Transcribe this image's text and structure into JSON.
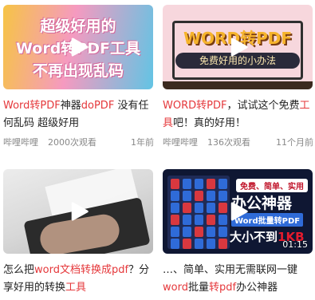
{
  "cards": [
    {
      "thumb": {
        "line1": "超级好用的",
        "line2": "Word转PDF工具",
        "line3": "不再出现乱码"
      },
      "title_segments": [
        {
          "text": "Word转PDF",
          "hl": true
        },
        {
          "text": "神器",
          "hl": false
        },
        {
          "text": "doPDF",
          "hl": true
        },
        {
          "text": " 没有任何乱码 超级好用",
          "hl": false
        }
      ],
      "author": "哔哩哔哩",
      "views": "2000次观看",
      "time": "1年前"
    },
    {
      "thumb": {
        "big": "WORD转PDF",
        "sub": "免费好用的小办法"
      },
      "title_segments": [
        {
          "text": "WORD转PDF",
          "hl": true
        },
        {
          "text": "，试试这个免费",
          "hl": false
        },
        {
          "text": "工具",
          "hl": true
        },
        {
          "text": "吧！真的好用！",
          "hl": false
        }
      ],
      "author": "哔哩哔哩",
      "views": "136次观看",
      "time": "11个月前"
    },
    {
      "thumb": {},
      "title_segments": [
        {
          "text": "怎么把",
          "hl": false
        },
        {
          "text": "word文档转换成pdf",
          "hl": true
        },
        {
          "text": "？分享好用的转换",
          "hl": false
        },
        {
          "text": "工具",
          "hl": true
        }
      ],
      "author": "",
      "views": "",
      "time": ""
    },
    {
      "thumb": {
        "badge": "免费、简单、实用",
        "big": "办公神器",
        "tag": "Word批量转PDF",
        "size_prefix": "大小不到",
        "size_value": "1KB",
        "duration": "01:15"
      },
      "title_segments": [
        {
          "text": "…、简单、实用无需联网一键",
          "hl": false
        },
        {
          "text": "word",
          "hl": true
        },
        {
          "text": "批量",
          "hl": false
        },
        {
          "text": "转pdf",
          "hl": true
        },
        {
          "text": "办公神器",
          "hl": false
        }
      ],
      "author": "",
      "views": "",
      "time": ""
    }
  ],
  "colors": {
    "highlight": "#e5383b",
    "meta": "#888888"
  },
  "icons": {
    "play": "play-icon"
  }
}
